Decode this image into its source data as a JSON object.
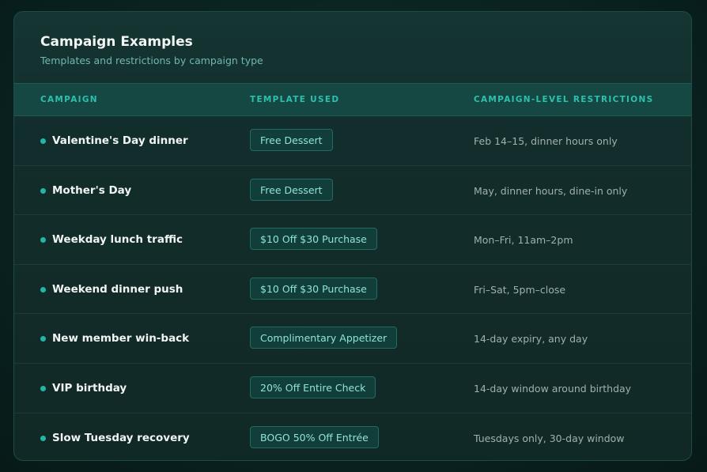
{
  "card": {
    "title": "Campaign Examples",
    "subtitle": "Templates and restrictions by campaign type"
  },
  "table": {
    "columns": [
      "CAMPAIGN",
      "TEMPLATE USED",
      "CAMPAIGN-LEVEL RESTRICTIONS"
    ],
    "rows": [
      {
        "campaign": "Valentine's Day dinner",
        "template": "Free Dessert",
        "restrictions": "Feb 14–15, dinner hours only"
      },
      {
        "campaign": "Mother's Day",
        "template": "Free Dessert",
        "restrictions": "May, dinner hours, dine-in only"
      },
      {
        "campaign": "Weekday lunch traffic",
        "template": "$10 Off $30 Purchase",
        "restrictions": "Mon–Fri, 11am–2pm"
      },
      {
        "campaign": "Weekend dinner push",
        "template": "$10 Off $30 Purchase",
        "restrictions": "Fri–Sat, 5pm–close"
      },
      {
        "campaign": "New member win-back",
        "template": "Complimentary Appetizer",
        "restrictions": "14-day expiry, any day"
      },
      {
        "campaign": "VIP birthday",
        "template": "20% Off Entire Check",
        "restrictions": "14-day window around birthday"
      },
      {
        "campaign": "Slow Tuesday recovery",
        "template": "BOGO 50% Off Entrée",
        "restrictions": "Tuesdays only, 30-day window"
      }
    ]
  },
  "colors": {
    "accent": "#2cc0ae",
    "badge_text": "#8fe3d6",
    "background": "#0a2321"
  }
}
